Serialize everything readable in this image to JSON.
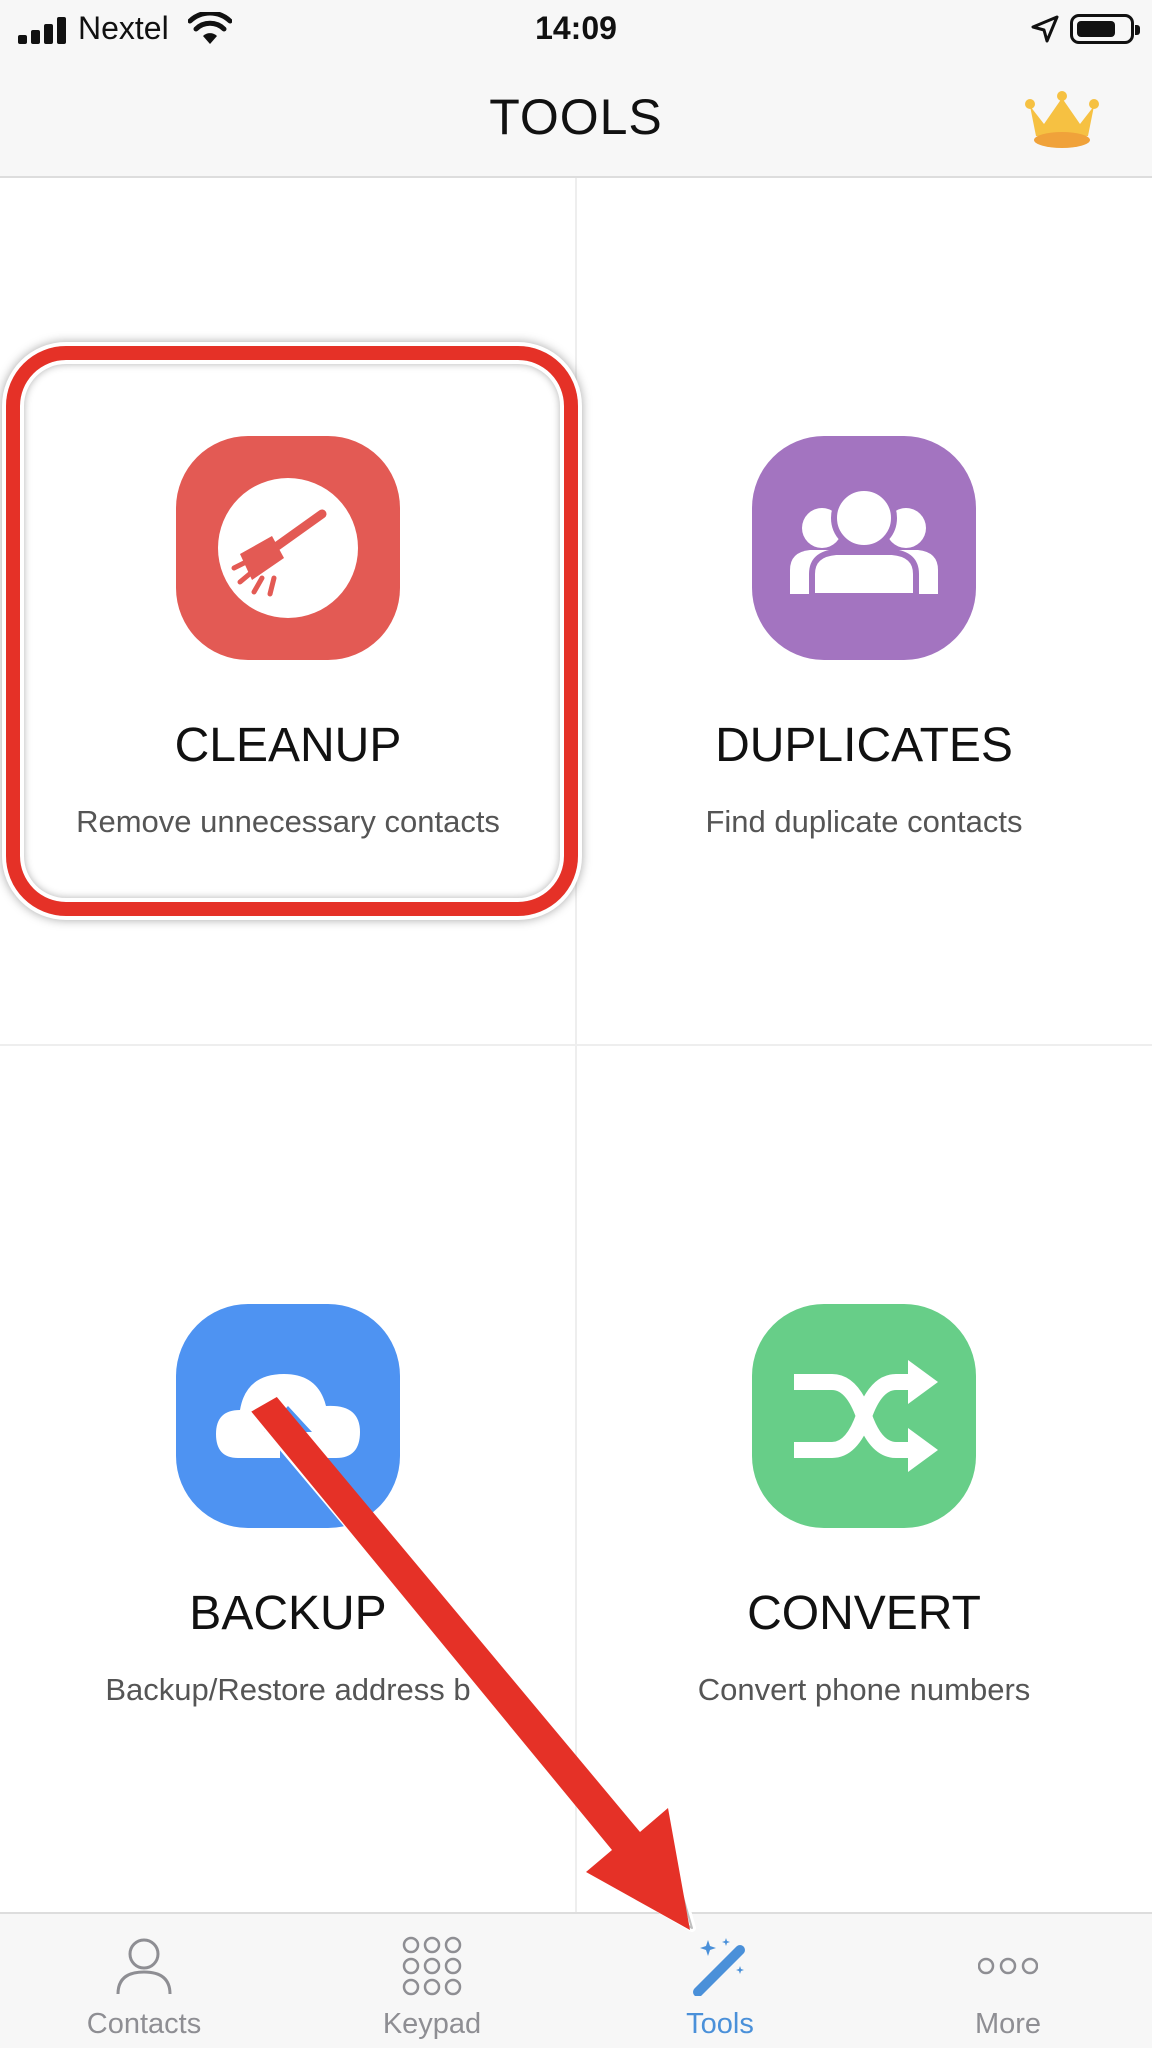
{
  "status_bar": {
    "carrier": "Nextel",
    "time": "14:09"
  },
  "nav": {
    "title": "TOOLS",
    "crown_icon": "crown-icon"
  },
  "tools": [
    {
      "title": "CLEANUP",
      "subtitle": "Remove unnecessary contacts",
      "icon": "broom-icon",
      "color": "#e35a54"
    },
    {
      "title": "DUPLICATES",
      "subtitle": "Find duplicate contacts",
      "icon": "people-icon",
      "color": "#a374c0"
    },
    {
      "title": "BACKUP",
      "subtitle": "Backup/Restore address b",
      "icon": "cloud-upload-icon",
      "color": "#4e93f2"
    },
    {
      "title": "CONVERT",
      "subtitle": "Convert phone numbers",
      "icon": "shuffle-icon",
      "color": "#67ce88"
    }
  ],
  "tab_bar": {
    "active": "Tools",
    "active_color": "#4a90d9",
    "tabs": [
      {
        "label": "Contacts",
        "icon": "person-icon"
      },
      {
        "label": "Keypad",
        "icon": "keypad-icon"
      },
      {
        "label": "Tools",
        "icon": "magic-wand-icon"
      },
      {
        "label": "More",
        "icon": "more-dots-icon"
      }
    ]
  },
  "annotation": {
    "highlight_color": "#e53127"
  }
}
